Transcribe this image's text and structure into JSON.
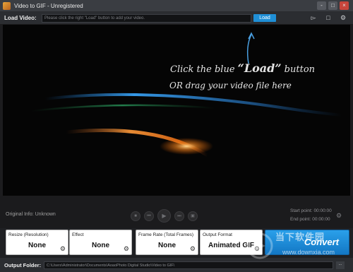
{
  "window": {
    "title": "Video to GIF - Unregistered",
    "buttons": [
      "-",
      "□",
      "×"
    ]
  },
  "load": {
    "label": "Load Video:",
    "placeholder": "Please click the right \"Load\" button to add your video.",
    "button": "Load"
  },
  "toolbar_icons": [
    "tag-icon",
    "comment-icon",
    "settings-icon"
  ],
  "preview": {
    "hint_line1_a": "Click the blue ",
    "hint_line1_b": "“Load”",
    "hint_line1_c": " button",
    "hint_line2": "OR drag your video file here"
  },
  "info": {
    "original": "Original Info: Unknown",
    "start_label": "Start point:",
    "start_value": "00:00:00",
    "end_label": "End point:",
    "end_value": "00:00:00"
  },
  "options": [
    {
      "label": "Resize (Resolution)",
      "value": "None"
    },
    {
      "label": "Effect",
      "value": "None"
    },
    {
      "label": "Frame Rate (Total Frames)",
      "value": "None"
    },
    {
      "label": "Output Format",
      "value": "Animated GIF"
    }
  ],
  "convert_label": "Convert",
  "output": {
    "label": "Output Folder:",
    "path": "C:\\Users\\Administrator\\Documents\\AoaoPhoto Digital Studio\\Video to GIF\\",
    "browse": "..."
  },
  "watermark": {
    "text": "当下软件园",
    "url": "www.downxia.com"
  }
}
